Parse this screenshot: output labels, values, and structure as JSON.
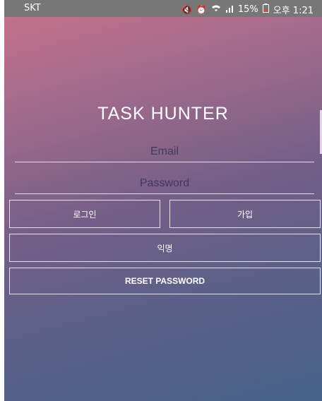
{
  "status_bar": {
    "carrier": "SKT",
    "battery_percent": "15%",
    "time": "오후 1:21",
    "icons": [
      "mute-icon",
      "alarm-icon",
      "wifi-icon",
      "signal-icon",
      "battery-icon"
    ]
  },
  "app": {
    "title": "TASK HUNTER"
  },
  "form": {
    "email_placeholder": "Email",
    "password_placeholder": "Password"
  },
  "buttons": {
    "login": "로그인",
    "signup": "가입",
    "anonymous": "익명",
    "reset": "RESET PASSWORD"
  },
  "colors": {
    "gradient_top": "#c8738a",
    "gradient_bottom": "#45618a",
    "status_bar": "#777777"
  }
}
